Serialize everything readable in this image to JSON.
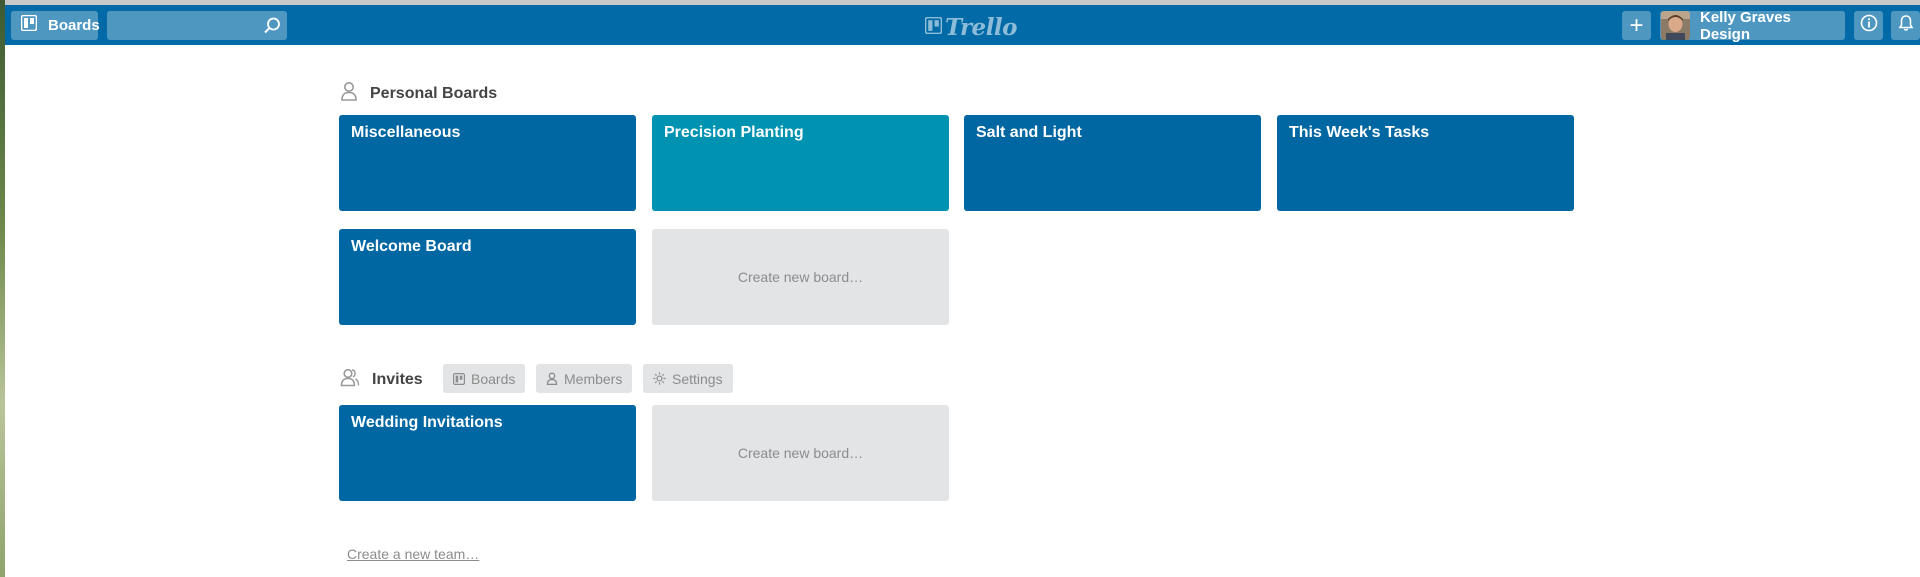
{
  "header": {
    "boards_label": "Boards",
    "search_value": "",
    "logo_text": "Trello",
    "add_label": "+",
    "user_name": "Kelly Graves Design"
  },
  "personal": {
    "title": "Personal Boards",
    "boards": [
      {
        "name": "Miscellaneous",
        "color": "#0067a3"
      },
      {
        "name": "Precision Planting",
        "color": "#0093b1"
      },
      {
        "name": "Salt and Light",
        "color": "#0067a3"
      },
      {
        "name": "This Week's Tasks",
        "color": "#0067a3"
      },
      {
        "name": "Welcome Board",
        "color": "#0067a3"
      }
    ],
    "create_label": "Create new board…"
  },
  "team": {
    "title": "Invites",
    "tabs": {
      "boards": "Boards",
      "members": "Members",
      "settings": "Settings"
    },
    "boards": [
      {
        "name": "Wedding Invitations",
        "color": "#0067a3"
      }
    ],
    "create_label": "Create new board…"
  },
  "create_team_label": "Create a new team…",
  "colors": {
    "header": "#026aa7",
    "board_blue": "#0067a3",
    "board_teal": "#0093b1",
    "create_tile": "#e2e4e6"
  }
}
